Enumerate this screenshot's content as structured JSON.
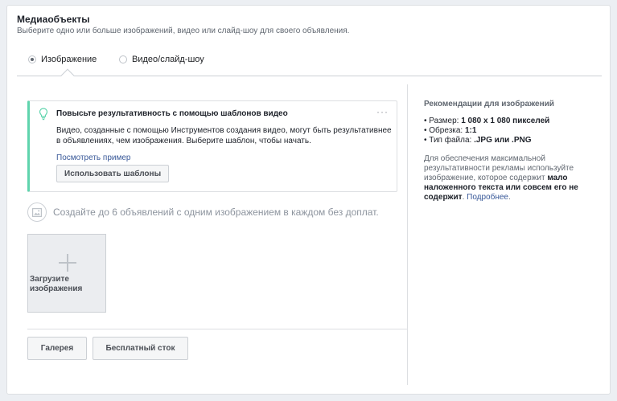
{
  "header": {
    "title": "Медиаобъекты",
    "subtitle": "Выберите одно или больше изображений, видео или слайд-шоу для своего объявления."
  },
  "tabs": [
    {
      "label": "Изображение",
      "selected": true
    },
    {
      "label": "Видео/слайд-шоу",
      "selected": false
    }
  ],
  "tip": {
    "icon": "lightbulb-icon",
    "title": "Повысьте результативность с помощью шаблонов видео",
    "more": "···",
    "body": "Видео, созданные с помощью Инструментов создания видео, могут быть результативнее в объявлениях, чем изображения. Выберите шаблон, чтобы начать.",
    "link": "Посмотреть пример",
    "button": "Использовать шаблоны"
  },
  "note": {
    "icon": "image-icon",
    "text": "Создайте до 6 объявлений с одним изображением в каждом без доплат."
  },
  "upload": {
    "icon": "plus-icon",
    "label": "Загрузите изображения"
  },
  "buttons": {
    "gallery": "Галерея",
    "stock": "Бесплатный сток"
  },
  "recommendations": {
    "title": "Рекомендации для изображений",
    "items": [
      {
        "label": "Размер: ",
        "value": "1 080 x 1 080 пикселей"
      },
      {
        "label": "Обрезка: ",
        "value": "1:1"
      },
      {
        "label": "Тип файла: ",
        "value": ".JPG или .PNG"
      }
    ],
    "text_before": "Для обеспечения максимальной результативности рекламы используйте изображение, которое содержит ",
    "text_bold": "мало наложенного текста или совсем его не содержит",
    "text_after": ". ",
    "link": "Подробнее",
    "text_end": "."
  },
  "colors": {
    "accent": "#5fd4ad",
    "link": "#385898"
  }
}
